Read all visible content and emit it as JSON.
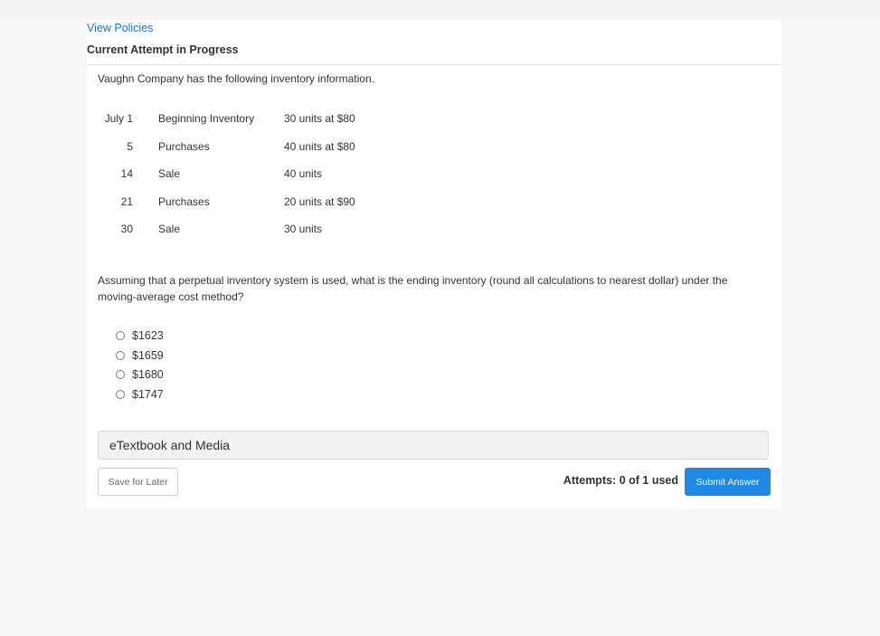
{
  "links": {
    "view_policies": "View Policies"
  },
  "status": {
    "attempt": "Current Attempt in Progress"
  },
  "question": {
    "intro": "Vaughn Company has the following inventory information.",
    "table": [
      {
        "date": "July 1",
        "description": "Beginning Inventory",
        "quantity": "30 units at $80"
      },
      {
        "date": "5",
        "description": "Purchases",
        "quantity": "40 units at $80"
      },
      {
        "date": "14",
        "description": "Sale",
        "quantity": "40 units"
      },
      {
        "date": "21",
        "description": "Purchases",
        "quantity": "20 units at $90"
      },
      {
        "date": "30",
        "description": "Sale",
        "quantity": "30 units"
      }
    ],
    "prompt": "Assuming that a perpetual inventory system is used, what is the ending inventory (round all calculations to nearest dollar) under the moving-average cost method?",
    "options": [
      {
        "label": "$1623"
      },
      {
        "label": "$1659"
      },
      {
        "label": "$1680"
      },
      {
        "label": "$1747"
      }
    ]
  },
  "resources": {
    "etextbook": "eTextbook and Media"
  },
  "footer": {
    "save_label": "Save for Later",
    "attempts_label": "Attempts: 0 of 1 used",
    "submit_label": "Submit Answer"
  },
  "colors": {
    "link": "#1a73c9",
    "submit_bg": "#1e88e5",
    "page_bg": "#f7f7f7"
  }
}
